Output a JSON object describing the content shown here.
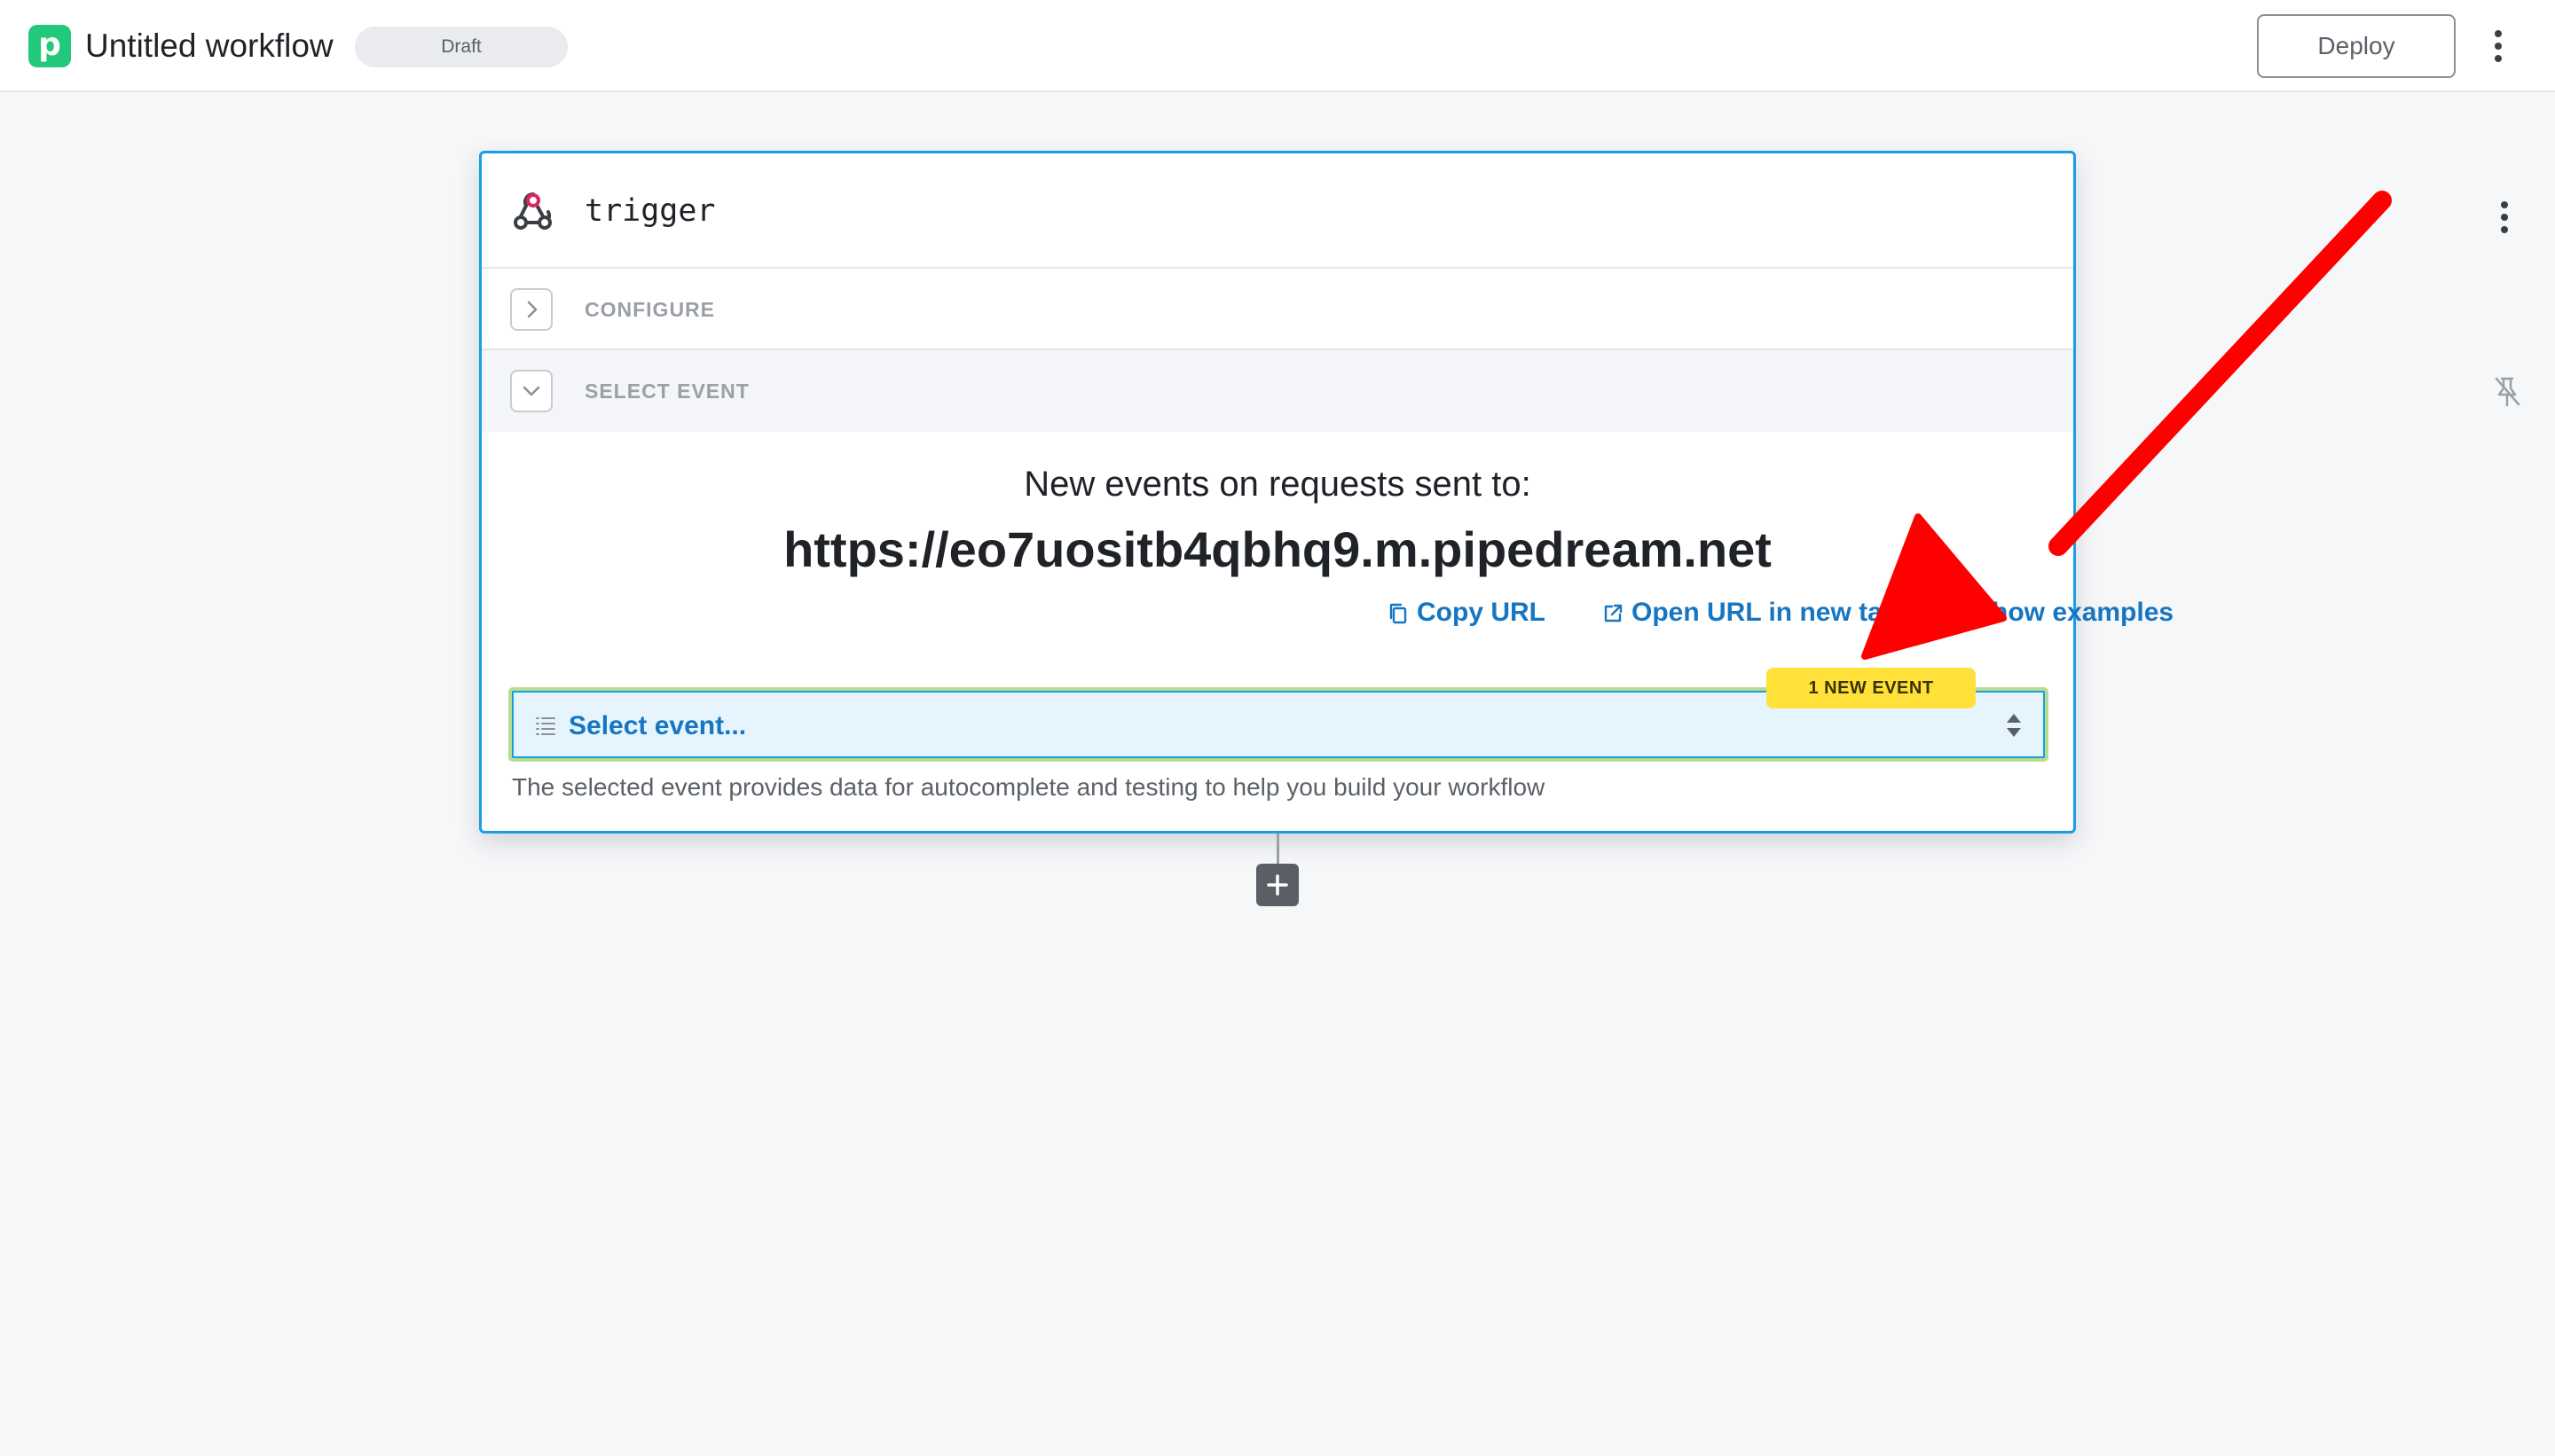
{
  "header": {
    "logo_letter": "p",
    "workflow_title": "Untitled workflow",
    "status_badge": "Draft",
    "deploy_label": "Deploy",
    "more_menu_icon": "vertical-ellipsis-icon"
  },
  "trigger_card": {
    "icon": "webhook-icon",
    "name": "trigger",
    "more_menu_icon": "vertical-ellipsis-icon",
    "sections": {
      "configure": {
        "label": "CONFIGURE",
        "icon": "chevron-right-icon"
      },
      "select_event": {
        "label": "SELECT EVENT",
        "icon": "chevron-down-icon",
        "pin_icon": "unpin-icon"
      }
    },
    "events_heading": "New events on requests sent to:",
    "endpoint_url": "https://eo7uositb4qbhq9.m.pipedream.net",
    "actions": {
      "copy_url": "Copy URL",
      "open_url": "Open URL in new tab",
      "show_examples": "Show examples"
    },
    "event_select": {
      "value": "Select event...",
      "badge": "1 NEW EVENT",
      "helper_text": "The selected event provides data for autocomplete and testing to help you build your workflow"
    }
  },
  "add_step": {
    "icon": "plus-icon"
  },
  "colors": {
    "brand_green": "#22c97a",
    "accent_blue": "#1a9ee2",
    "link_blue": "#1676c2",
    "badge_yellow": "#ffe13a",
    "annotation_red": "#ff0000"
  }
}
